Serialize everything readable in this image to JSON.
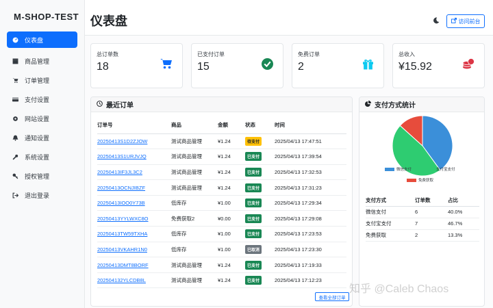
{
  "brand": "M-SHOP-TEST",
  "sidebar": {
    "items": [
      {
        "label": "仪表盘",
        "icon": "dashboard-icon",
        "active": true
      },
      {
        "label": "商品管理",
        "icon": "box-icon"
      },
      {
        "label": "订单管理",
        "icon": "cart-icon"
      },
      {
        "label": "支付设置",
        "icon": "credit-card-icon"
      },
      {
        "label": "网站设置",
        "icon": "gear-icon"
      },
      {
        "label": "通知设置",
        "icon": "bell-icon"
      },
      {
        "label": "系统设置",
        "icon": "wrench-icon"
      },
      {
        "label": "授权管理",
        "icon": "key-icon"
      },
      {
        "label": "退出登录",
        "icon": "logout-icon"
      }
    ]
  },
  "header": {
    "title": "仪表盘",
    "theme_icon": "moon-icon",
    "visit_label": "访问前台"
  },
  "stats": [
    {
      "label": "总订单数",
      "value": "18",
      "icon": "cart-icon",
      "color": "#0d6efd"
    },
    {
      "label": "已支付订单",
      "value": "15",
      "icon": "check-circle-icon",
      "color": "#198754"
    },
    {
      "label": "免费订单",
      "value": "2",
      "icon": "gift-icon",
      "color": "#0dcaf0"
    },
    {
      "label": "总收入",
      "value": "¥15.92",
      "icon": "coins-icon",
      "color": "#dc3545"
    }
  ],
  "recent_orders": {
    "title": "最近订单",
    "columns": [
      "订单号",
      "商品",
      "金额",
      "状态",
      "时间"
    ],
    "rows": [
      {
        "id": "20250413S1D2ZJOW",
        "product": "测试商品管理",
        "amount": "¥1.24",
        "status": "待支付",
        "status_type": "warning",
        "time": "2025/04/13 17:47:51"
      },
      {
        "id": "20250413S1URJVJQ",
        "product": "测试商品管理",
        "amount": "¥1.24",
        "status": "已支付",
        "status_type": "success",
        "time": "2025/04/13 17:39:54"
      },
      {
        "id": "20250413IF3JL3C2",
        "product": "测试商品管理",
        "amount": "¥1.24",
        "status": "已支付",
        "status_type": "success",
        "time": "2025/04/13 17:32:53"
      },
      {
        "id": "20250413OCNJIBZF",
        "product": "测试商品管理",
        "amount": "¥1.24",
        "status": "已支付",
        "status_type": "success",
        "time": "2025/04/13 17:31:23"
      },
      {
        "id": "20250413IOO0Y73B",
        "product": "低库存",
        "amount": "¥1.00",
        "status": "已支付",
        "status_type": "success",
        "time": "2025/04/13 17:29:34"
      },
      {
        "id": "20250413YYLWXC8O",
        "product": "免费获取2",
        "amount": "¥0.00",
        "status": "已支付",
        "status_type": "success",
        "time": "2025/04/13 17:29:08"
      },
      {
        "id": "20250413TW59TXHA",
        "product": "低库存",
        "amount": "¥1.00",
        "status": "已支付",
        "status_type": "success",
        "time": "2025/04/13 17:23:53"
      },
      {
        "id": "20250413VKAHR1N0",
        "product": "低库存",
        "amount": "¥1.00",
        "status": "已取消",
        "status_type": "secondary",
        "time": "2025/04/13 17:23:30"
      },
      {
        "id": "20250413DMT8BORF",
        "product": "测试商品管理",
        "amount": "¥1.24",
        "status": "已支付",
        "status_type": "success",
        "time": "2025/04/13 17:19:33"
      },
      {
        "id": "2025041​32YLCDB8L",
        "product": "测试商品管理",
        "amount": "¥1.24",
        "status": "已支付",
        "status_type": "success",
        "time": "2025/04/13 17:12:23"
      }
    ],
    "view_all": "查看全部订单"
  },
  "payment_stats": {
    "title": "支付方式统计",
    "columns": [
      "支付方式",
      "订单数",
      "占比"
    ],
    "rows": [
      {
        "method": "微信支付",
        "count": "6",
        "pct": "40.0%"
      },
      {
        "method": "支付宝支付",
        "count": "7",
        "pct": "46.7%"
      },
      {
        "method": "免费获取",
        "count": "2",
        "pct": "13.3%"
      }
    ]
  },
  "chart_data": {
    "type": "pie",
    "categories": [
      "微信支付",
      "支付宝支付",
      "免费获取"
    ],
    "values": [
      6,
      7,
      2
    ],
    "colors": [
      "#3b8fd9",
      "#2ecc71",
      "#e74c3c"
    ],
    "legend": "bottom"
  },
  "watermark": "知乎 @Caleb Chaos"
}
